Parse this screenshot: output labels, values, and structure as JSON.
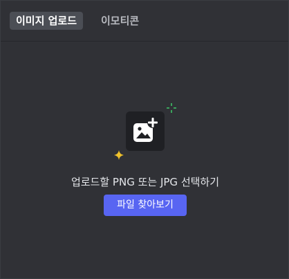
{
  "tabs": [
    {
      "label": "이미지 업로드",
      "active": true
    },
    {
      "label": "이모티콘",
      "active": false
    }
  ],
  "upload": {
    "icon": "image-add-icon",
    "prompt": "업로드할 PNG 또는 JPG 선택하기",
    "browse_label": "파일 찾아보기",
    "decorations": [
      "sparkle-green-icon",
      "sparkle-yellow-icon"
    ]
  },
  "colors": {
    "background": "#303136",
    "tab_active_bg": "#4b4e55",
    "icon_tile_bg": "#1f2024",
    "button_bg": "#5865f2",
    "sparkle_green": "#3ba55d",
    "sparkle_yellow": "#f0c22c"
  }
}
